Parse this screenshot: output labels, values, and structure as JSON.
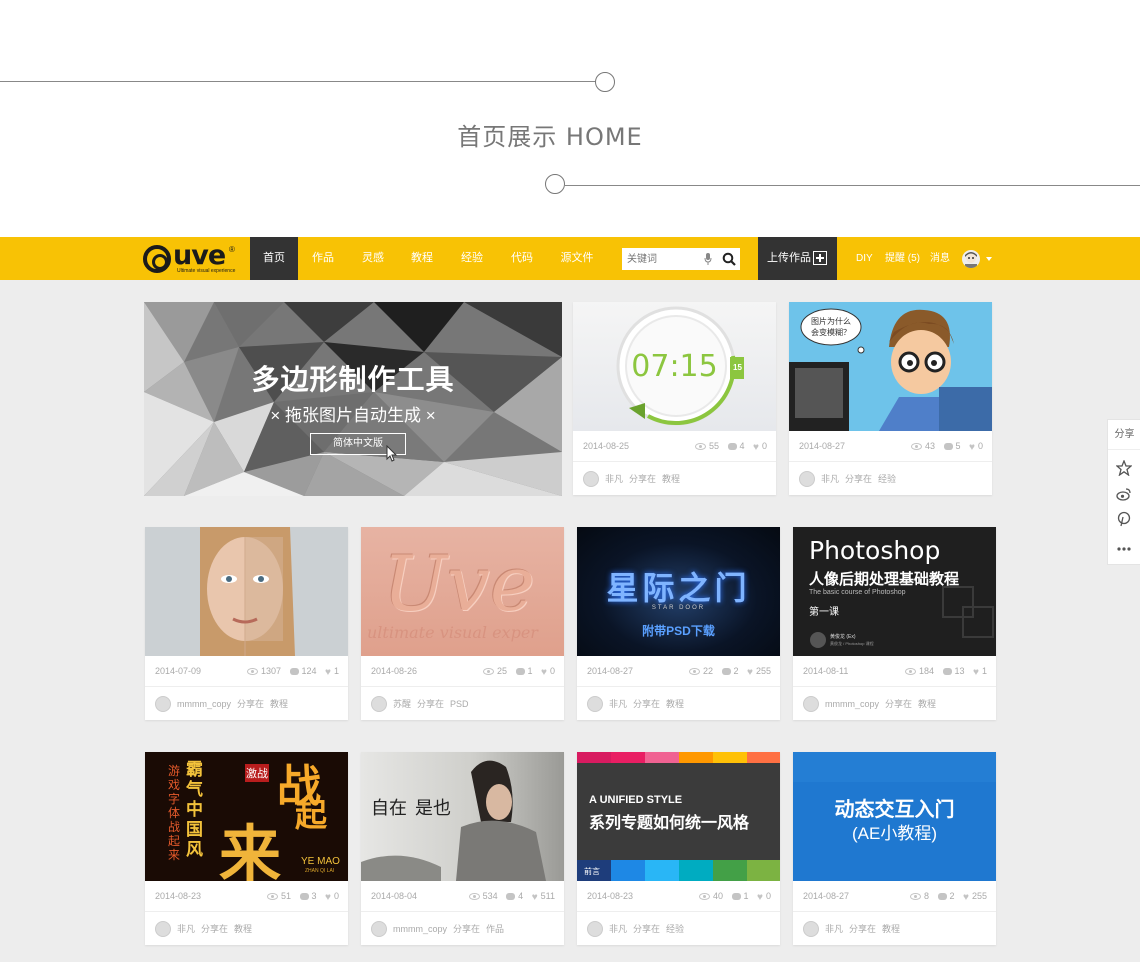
{
  "page": {
    "heading": "首页展示 HOME"
  },
  "nav": {
    "logo_text": "uve",
    "logo_reg": "®",
    "logo_tagline": "Ultimate visual experience",
    "items": [
      {
        "label": "首页",
        "active": true
      },
      {
        "label": "作品",
        "active": false
      },
      {
        "label": "灵感",
        "active": false
      },
      {
        "label": "教程",
        "active": false
      },
      {
        "label": "经验",
        "active": false
      },
      {
        "label": "代码",
        "active": false
      },
      {
        "label": "源文件",
        "active": false
      }
    ],
    "search_placeholder": "关键词",
    "upload_label": "上传作品",
    "diy_label": "DIY",
    "reminder_label": "提醒",
    "reminder_count": "(5)",
    "message_label": "消息",
    "accent": "#f8c205",
    "dark": "#333333"
  },
  "hero": {
    "title": "多边形制作工具",
    "subtitle": "× 拖张图片自动生成 ×",
    "button": "简体中文版"
  },
  "cards": [
    {
      "thumb_key": "clock",
      "date": "2014-08-25",
      "views": "55",
      "comments": "4",
      "likes": "0",
      "author": "非凡",
      "action": "分享在",
      "category": "教程",
      "thumb_text": [
        "07:15",
        "15"
      ]
    },
    {
      "thumb_key": "cartoon",
      "date": "2014-08-27",
      "views": "43",
      "comments": "5",
      "likes": "0",
      "author": "非凡",
      "action": "分享在",
      "category": "经验",
      "thumb_text": [
        "图片为什么",
        "会变模糊？"
      ]
    },
    {
      "thumb_key": "face",
      "date": "2014-07-09",
      "views": "1307",
      "comments": "124",
      "likes": "1",
      "author": "mmmm_copy",
      "action": "分享在",
      "category": "教程",
      "thumb_text": []
    },
    {
      "thumb_key": "uve",
      "date": "2014-08-26",
      "views": "25",
      "comments": "1",
      "likes": "0",
      "author": "苏醒",
      "action": "分享在",
      "category": "PSD",
      "thumb_text": [
        "Uve",
        "ultimate visual exper"
      ]
    },
    {
      "thumb_key": "star",
      "date": "2014-08-27",
      "views": "22",
      "comments": "2",
      "likes": "255",
      "author": "非凡",
      "action": "分享在",
      "category": "教程",
      "thumb_text": [
        "星际之门",
        "STAR DOOR",
        "附带PSD下载"
      ]
    },
    {
      "thumb_key": "ps",
      "date": "2014-08-11",
      "views": "184",
      "comments": "13",
      "likes": "1",
      "author": "mmmm_copy",
      "action": "分享在",
      "category": "教程",
      "thumb_text": [
        "Photoshop",
        "人像后期处理基础教程",
        "The basic course of Photoshop",
        "第一课",
        "黄俊龙 (Ex)",
        "黄俊龙 / Photoshop 课程"
      ]
    },
    {
      "thumb_key": "war",
      "date": "2014-08-23",
      "views": "51",
      "comments": "3",
      "likes": "0",
      "author": "非凡",
      "action": "分享在",
      "category": "教程",
      "thumb_text": [
        "霸气中国风",
        "游戏字体战起来",
        "战",
        "起",
        "来",
        "YE MAO",
        "ZHAN QI LAI",
        "激战"
      ]
    },
    {
      "thumb_key": "fashion",
      "date": "2014-08-04",
      "views": "534",
      "comments": "4",
      "likes": "511",
      "author": "mmmm_copy",
      "action": "分享在",
      "category": "作品",
      "thumb_text": [
        "自在",
        "是也"
      ]
    },
    {
      "thumb_key": "unified",
      "date": "2014-08-23",
      "views": "40",
      "comments": "1",
      "likes": "0",
      "author": "非凡",
      "action": "分享在",
      "category": "经验",
      "thumb_text": [
        "A UNIFIED STYLE",
        "系列专题如何统一风格",
        "前言"
      ]
    },
    {
      "thumb_key": "ae",
      "date": "2014-08-27",
      "views": "8",
      "comments": "2",
      "likes": "255",
      "author": "非凡",
      "action": "分享在",
      "category": "教程",
      "thumb_text": [
        "动态交互入门",
        "(AE小教程)"
      ]
    }
  ],
  "share": {
    "label": "分享",
    "icons": [
      "star-icon",
      "weibo-icon",
      "pinterest-icon",
      "more-icon"
    ]
  }
}
